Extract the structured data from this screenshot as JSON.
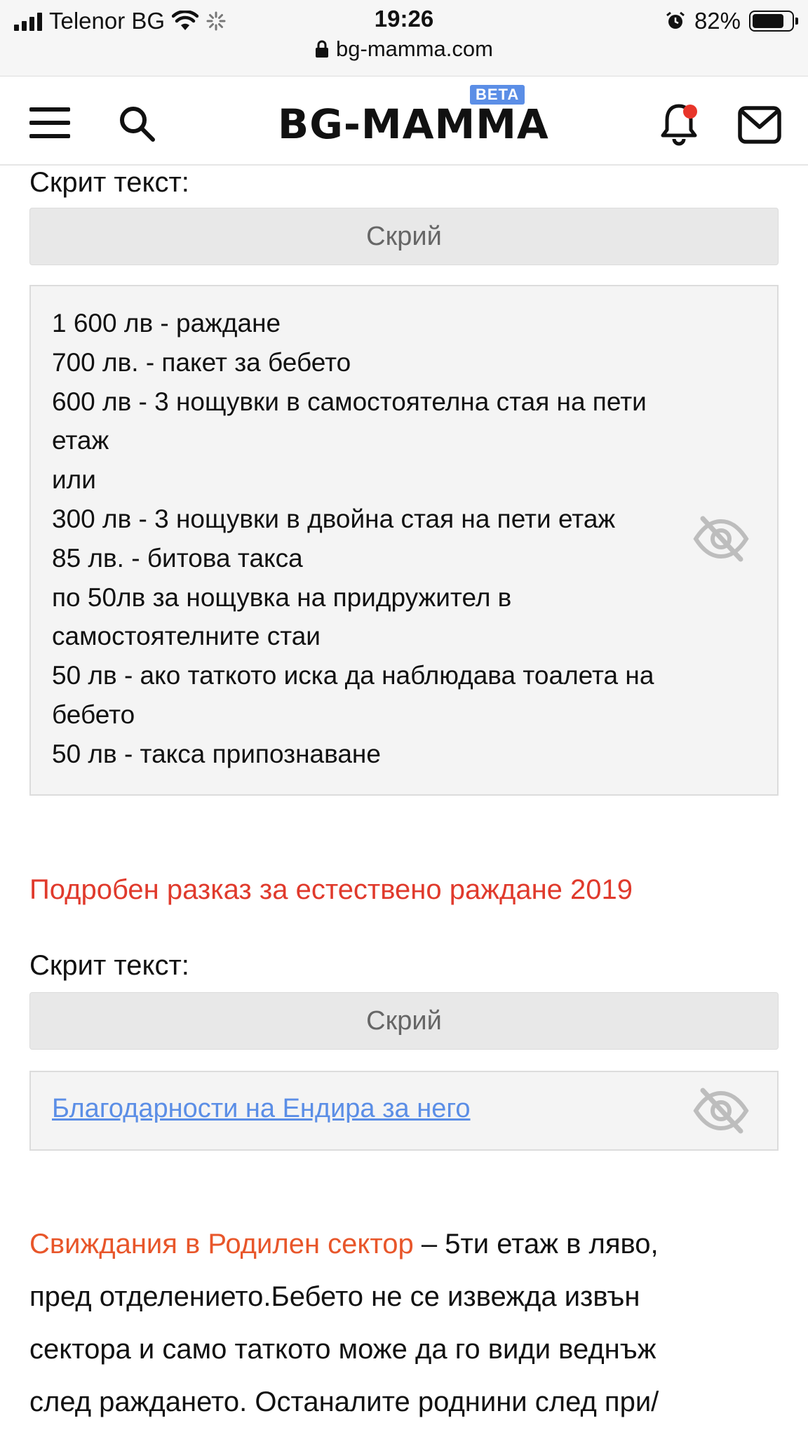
{
  "status_bar": {
    "carrier": "Telenor BG",
    "time": "19:26",
    "battery": "82%",
    "battery_level": 0.82
  },
  "browser": {
    "url": "bg-mamma.com"
  },
  "header": {
    "logo": "BG-MAMMA",
    "beta_badge": "BETA",
    "icons": [
      "menu-icon",
      "search-icon",
      "bell-icon",
      "mail-icon"
    ]
  },
  "content": {
    "spoiler1": {
      "label": "Скрит текст:",
      "button": "Скрий",
      "lines": [
        "1 600 лв - раждане",
        "700 лв. - пакет за бебето",
        "600 лв - 3 нощувки в самостоятелна стая на пети",
        "етаж",
        "или",
        "300 лв - 3 нощувки в двойна стая на пети етаж",
        "85 лв. - битова такса",
        "по 50лв за нощувка на придружител в",
        "самостоятелните стаи",
        "50 лв - ако таткото иска да наблюдава тоалета на",
        "бебето",
        "50 лв - такса припознаване"
      ]
    },
    "story_link": "Подробен разказ за естествено раждане 2019",
    "spoiler2": {
      "label": "Скрит текст:",
      "button": "Скрий",
      "link": "Благодарности на Ендира за него"
    },
    "visits": {
      "highlight": "Свиждания в Родилен сектор",
      "text_line1": " – 5ти етаж в ляво,",
      "text_line2": "пред отделението.Бебето не се извежда извън",
      "text_line3": "сектора и само таткото може да го види веднъж",
      "text_line4": "след раждането. Останалите роднини след при/"
    }
  },
  "colors": {
    "red_link": "#e03a2c",
    "blue_link": "#5b8ee6",
    "orange_highlight": "#e8562a",
    "beta_badge": "#5b8ee6",
    "notification_dot": "#e8352a"
  }
}
